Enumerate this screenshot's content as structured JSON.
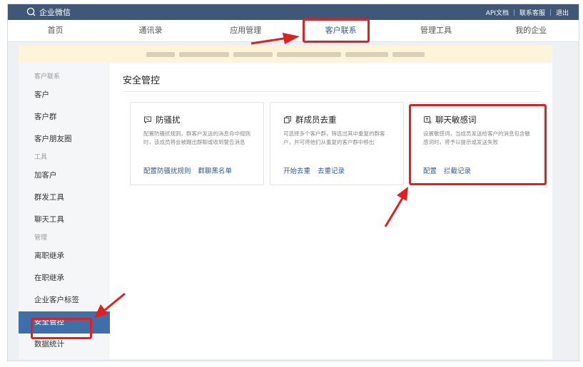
{
  "topbar": {
    "brand": "企业微信",
    "links": [
      "API文档",
      "联系客服",
      "退出"
    ]
  },
  "nav": {
    "items": [
      "首页",
      "通讯录",
      "应用管理",
      "客户联系",
      "管理工具",
      "我的企业"
    ],
    "active": "客户联系"
  },
  "sidebar": {
    "group1": "客户联系",
    "group1_items": [
      "客户",
      "客户群",
      "客户朋友圈"
    ],
    "group2": "工具",
    "group2_items": [
      "加客户",
      "群发工具",
      "聊天工具"
    ],
    "group3": "管理",
    "group3_items": [
      "离职继承",
      "在职继承",
      "企业客户标签",
      "安全管控",
      "数据统计"
    ],
    "active": "安全管控"
  },
  "main": {
    "title": "安全管控",
    "cards": [
      {
        "icon": "harassment-icon",
        "title": "防骚扰",
        "desc": "配置防骚扰规则，群客户发送的消息命中规则时，该成员将会被踢出群聊或收到警告消息",
        "links": [
          "配置防骚扰规则",
          "群聊黑名单"
        ]
      },
      {
        "icon": "dedup-icon",
        "title": "群成员去重",
        "desc": "可选择多个客户群，筛选出其中重复的群客户，并可将他们从重复的客户群中移出",
        "links": [
          "开始去重",
          "去重记录"
        ]
      },
      {
        "icon": "sensitive-word-icon",
        "title": "聊天敏感词",
        "desc": "设置敏感词，当成员发送给客户的消息包含敏感词时，将予以提示或发送失败",
        "links": [
          "配置",
          "拦截记录"
        ]
      }
    ]
  },
  "colors": {
    "topbar": "#3f5877",
    "link": "#2b5b9c",
    "active_sidebar": "#3f6fa8",
    "highlight": "#e02020",
    "notice": "#fdf4da"
  }
}
